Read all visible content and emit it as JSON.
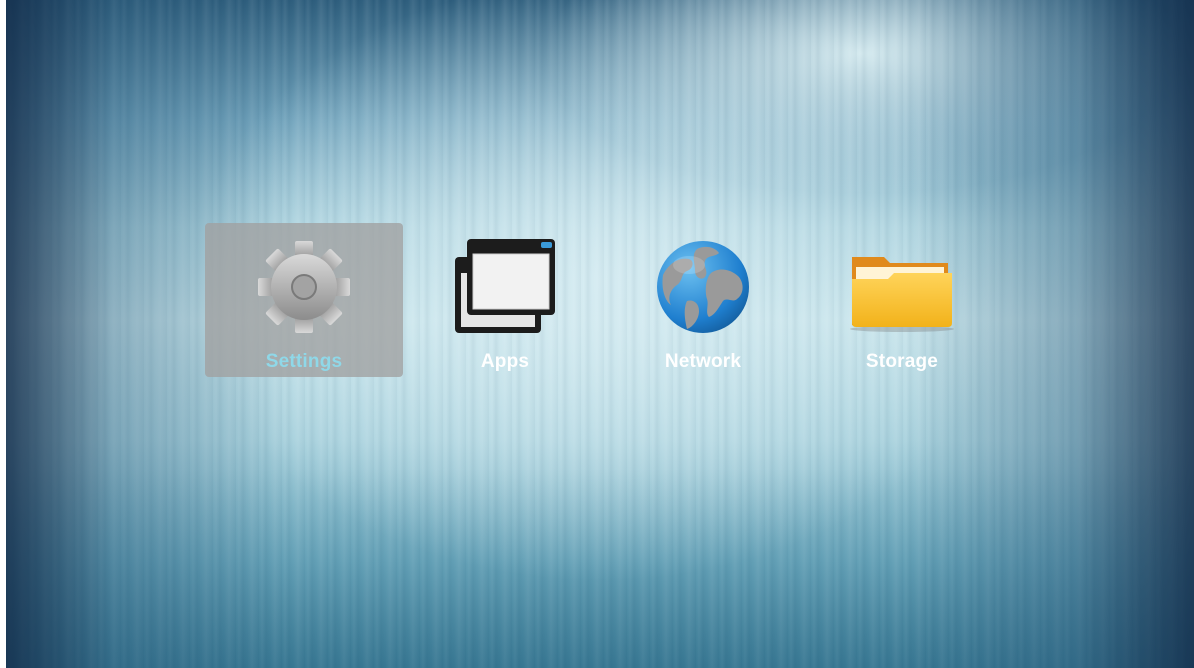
{
  "menu": {
    "items": [
      {
        "label": "Settings",
        "icon": "gear-icon",
        "selected": true
      },
      {
        "label": "Apps",
        "icon": "windows-icon",
        "selected": false
      },
      {
        "label": "Network",
        "icon": "globe-icon",
        "selected": false
      },
      {
        "label": "Storage",
        "icon": "folder-icon",
        "selected": false
      }
    ],
    "selected_index": 0
  },
  "colors": {
    "selection_background": "#a0a0a0",
    "selected_label": "#8fd8e8",
    "label": "#ffffff",
    "background_light": "#c5e3ea",
    "background_dark": "#2f5f7e"
  }
}
